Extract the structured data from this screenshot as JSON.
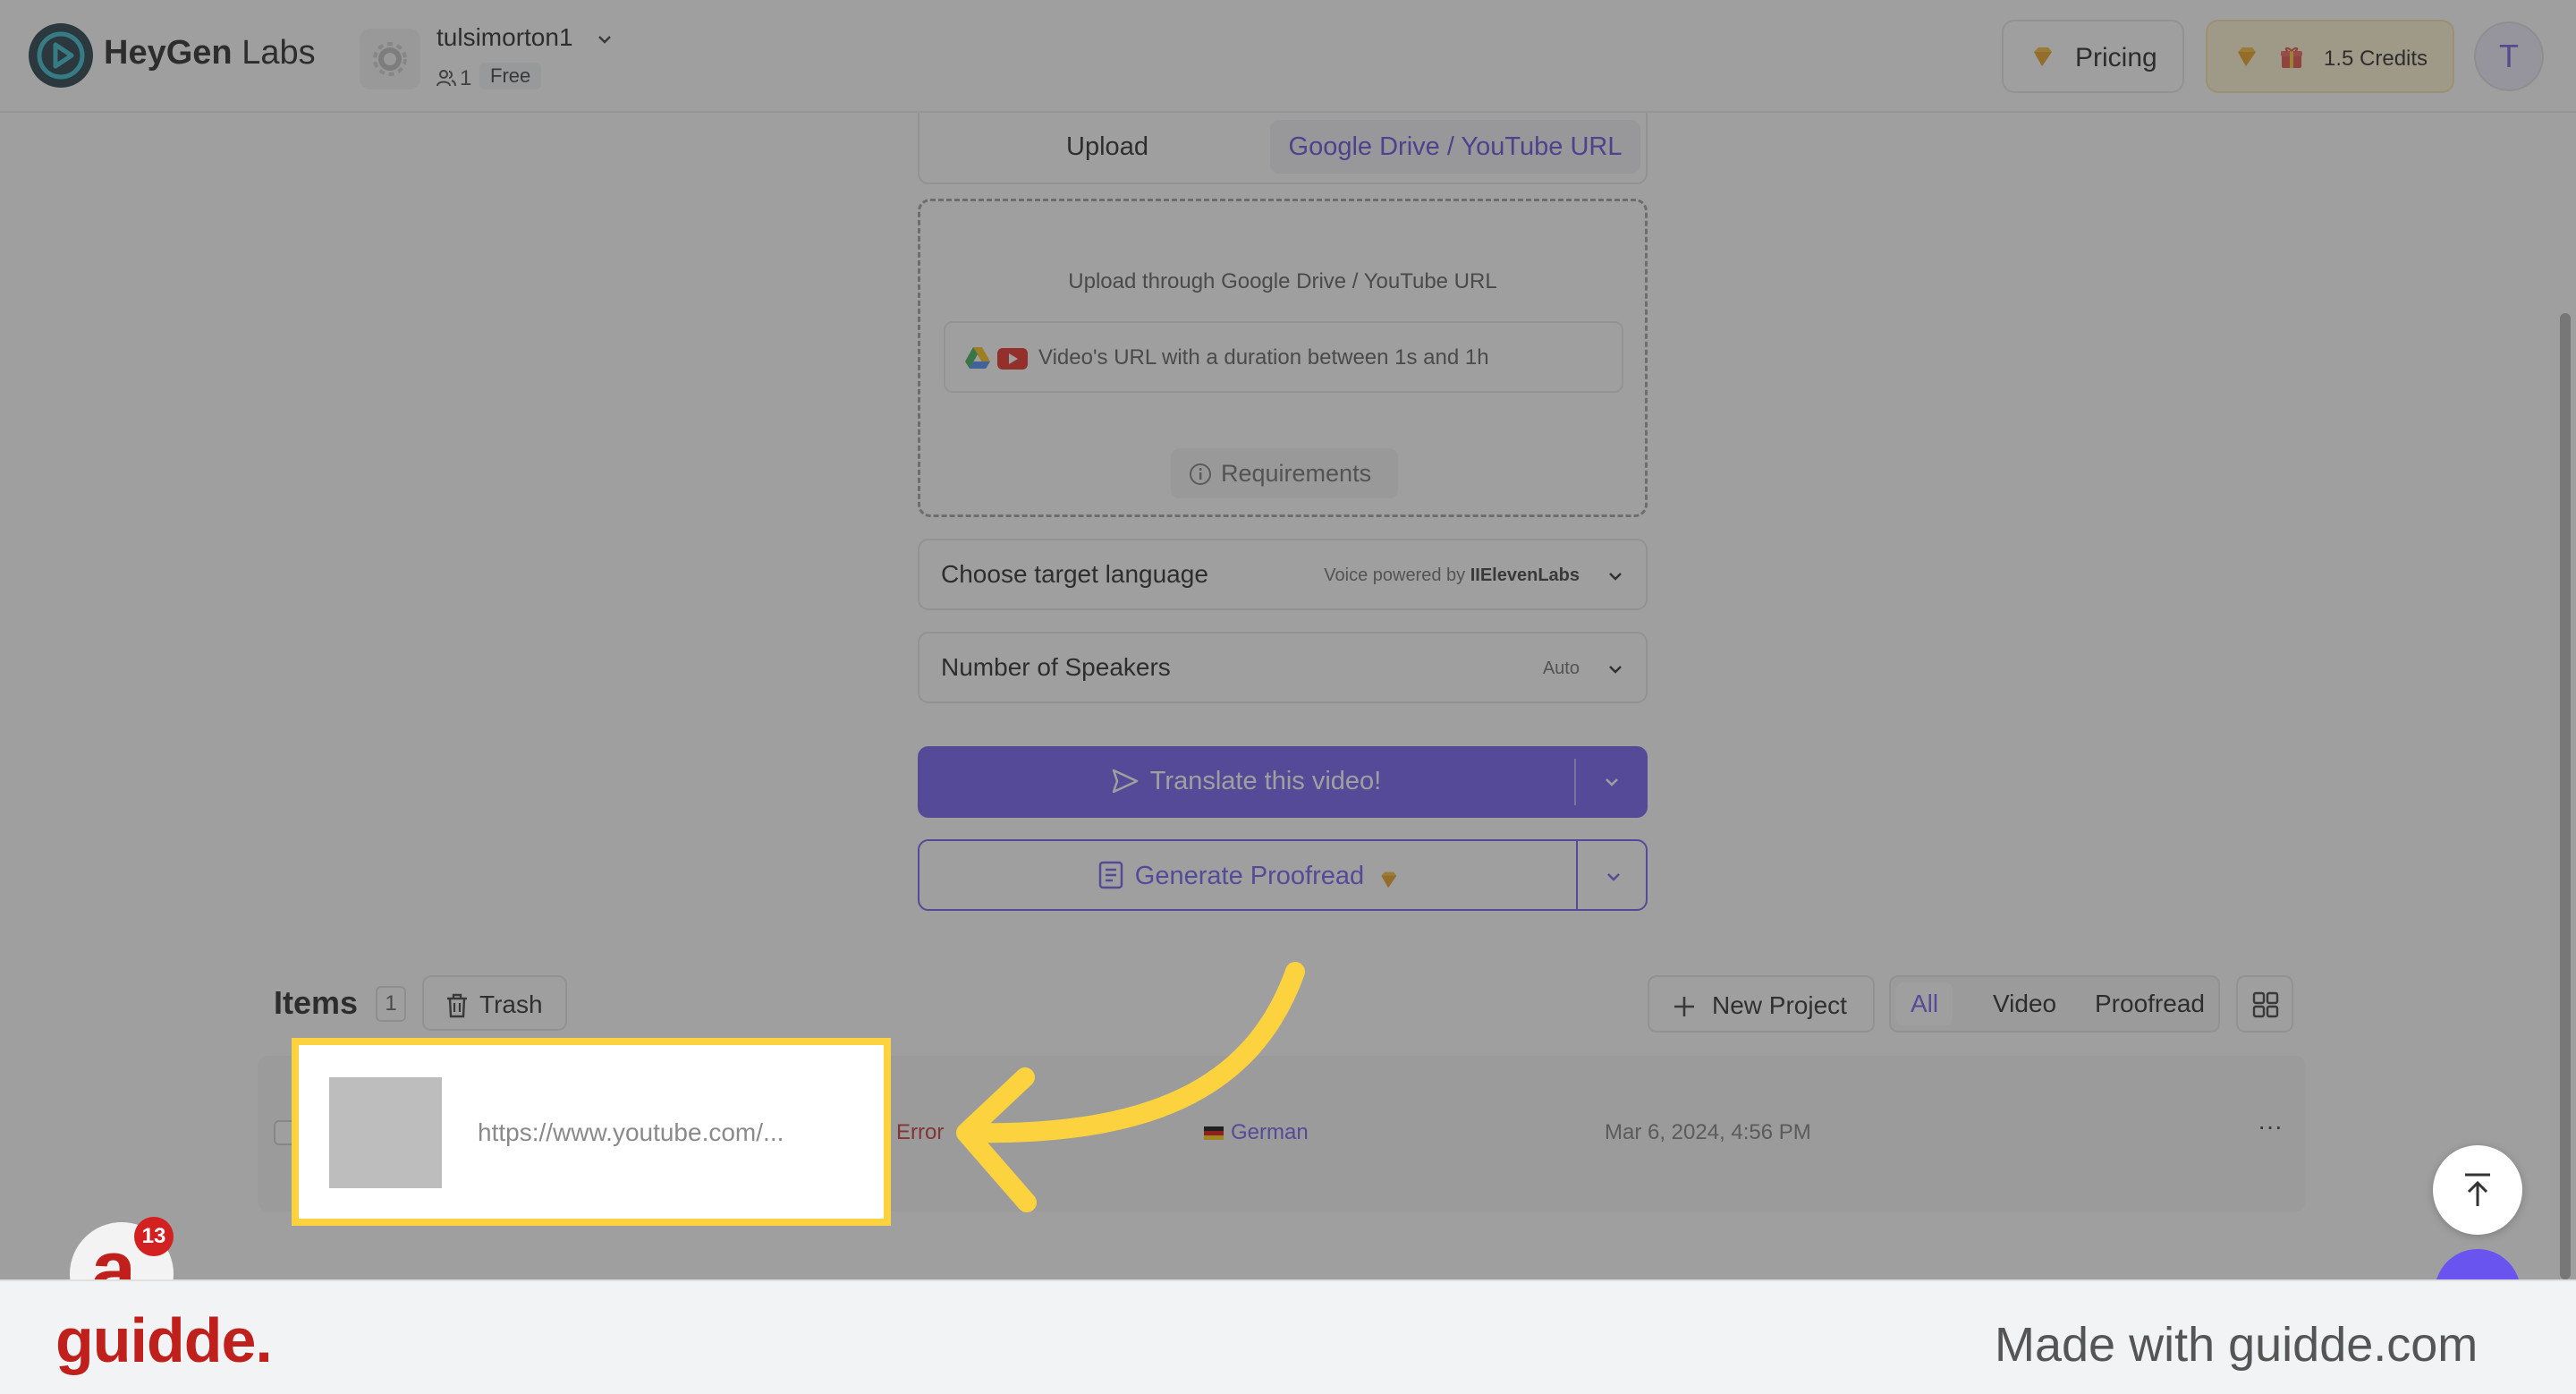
{
  "header": {
    "logo_text": "HeyGen",
    "logo_suffix": "Labs",
    "workspace_name": "tulsimorton1",
    "workspace_members": "1",
    "workspace_plan": "Free",
    "pricing_label": "Pricing",
    "credits_label": "1.5 Credits",
    "user_initial": "T"
  },
  "upload": {
    "tabs": [
      "Upload",
      "Google Drive / YouTube URL"
    ],
    "active_tab": "Google Drive / YouTube URL",
    "dropzone_title": "Upload through Google Drive / YouTube URL",
    "url_placeholder": "Video's URL with a duration between 1s and 1h",
    "requirements_label": "Requirements"
  },
  "target_language": {
    "label": "Choose target language",
    "hint": "Voice powered by",
    "brand": "IIElevenLabs"
  },
  "speakers": {
    "label": "Number of Speakers",
    "value": "Auto"
  },
  "actions": {
    "translate_label": "Translate this video!",
    "proofread_label": "Generate Proofread"
  },
  "items": {
    "title": "Items",
    "count": "1",
    "trash_label": "Trash",
    "new_project_label": "New Project",
    "filters": [
      "All",
      "Video",
      "Proofread"
    ],
    "active_filter": "All",
    "rows": [
      {
        "url": "https://www.youtube.com/...",
        "status": "Error",
        "language": "German",
        "date": "Mar 6, 2024, 4:56 PM",
        "more": "···"
      }
    ]
  },
  "widgets": {
    "guidde_glyph": "a",
    "guidde_badge": "13"
  },
  "footer": {
    "logo": "guidde.",
    "made_with": "Made with guidde.com"
  },
  "colors": {
    "accent": "#6a54f0",
    "highlight": "#fdd23f",
    "error": "#c62828",
    "guidde_red": "#c0201c"
  }
}
